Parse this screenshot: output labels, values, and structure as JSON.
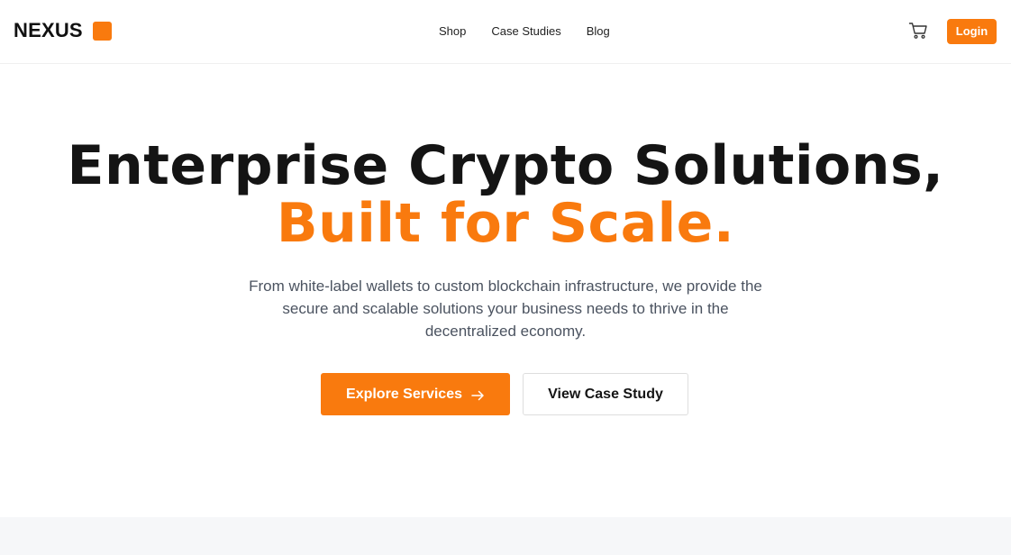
{
  "brand": {
    "name": "NEXUS",
    "accent_color": "#f97a0e"
  },
  "nav": {
    "items": [
      {
        "label": "Shop"
      },
      {
        "label": "Case Studies"
      },
      {
        "label": "Blog"
      }
    ]
  },
  "header": {
    "cart_icon": "shopping-cart-icon",
    "login_label": "Login"
  },
  "hero": {
    "title_line1": "Enterprise Crypto Solutions,",
    "title_line2": "Built for Scale.",
    "subtitle": "From white-label wallets to custom blockchain infrastructure, we provide the secure and scalable solutions your business needs to thrive in the decentralized economy.",
    "primary_button": "Explore Services",
    "primary_button_icon": "arrow-right-icon",
    "secondary_button": "View Case Study"
  }
}
